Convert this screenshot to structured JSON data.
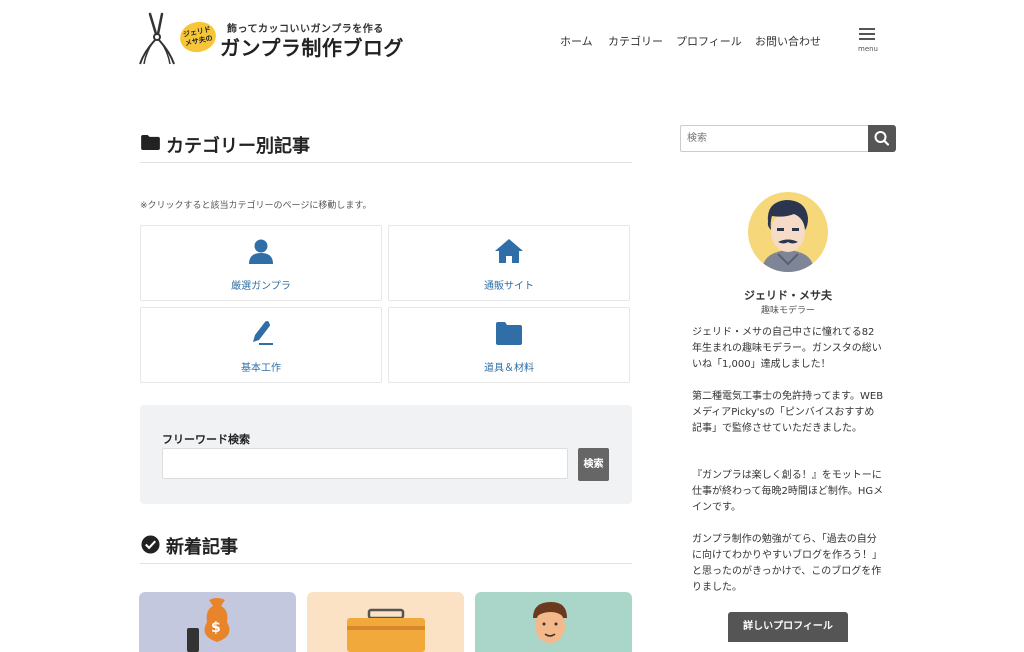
{
  "header": {
    "logo_badge": "ジェリド メサ夫の",
    "tagline": "飾ってカッコいいガンプラを作る",
    "site_title": "ガンプラ制作ブログ",
    "nav": [
      "ホーム",
      "カテゴリー",
      "プロフィール",
      "お問い合わせ"
    ],
    "menu_label": "menu"
  },
  "main": {
    "category_heading": "カテゴリー別記事",
    "note": "※クリックすると該当カテゴリーのページに移動します。",
    "categories": [
      {
        "label": "厳選ガンプラ",
        "icon": "user-icon"
      },
      {
        "label": "通販サイト",
        "icon": "home-icon"
      },
      {
        "label": "基本工作",
        "icon": "pen-icon"
      },
      {
        "label": "道具＆材料",
        "icon": "folder-icon"
      }
    ],
    "freeword": {
      "title": "フリーワード検索",
      "input_value": "",
      "button_label": "検索"
    },
    "new_heading": "新着記事"
  },
  "sidebar": {
    "search_placeholder": "検索",
    "profile": {
      "name": "ジェリド・メサ夫",
      "role": "趣味モデラー",
      "p1": "ジェリド・メサの自己中さに憧れてる82年生まれの趣味モデラー。ガンスタの総いいね「1,000」達成しました！",
      "p2": "第二種電気工事士の免許持ってます。WEBメディアPicky'sの「ピンバイスおすすめ記事」で監修させていただきました。",
      "p3": "『ガンプラは楽しく創る！』をモットーに仕事が終わって毎晩2時間ほど制作。HGメインです。",
      "p4": "ガンプラ制作の勉強がてら、「過去の自分に向けてわかりやすいブログを作ろう！」と思ったのがきっかけで、このブログを作りました。",
      "button_label": "詳しいプロフィール"
    }
  },
  "colors": {
    "accent_blue": "#2f6ea6",
    "badge_yellow": "#f6c638",
    "button_gray": "#555555"
  }
}
